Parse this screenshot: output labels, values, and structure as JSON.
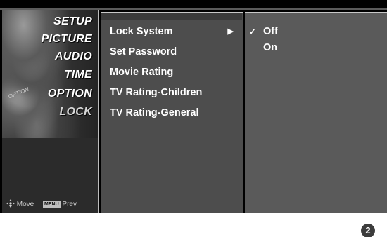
{
  "left_panel": {
    "categories": [
      {
        "label": "SETUP"
      },
      {
        "label": "PICTURE"
      },
      {
        "label": "AUDIO"
      },
      {
        "label": "TIME"
      },
      {
        "label": "OPTION"
      },
      {
        "label": "LOCK",
        "active": true
      }
    ],
    "nav_hint": {
      "move_icon": "move-arrows-icon",
      "move_label": "Move",
      "menu_key": "MENU",
      "prev_label": "Prev"
    }
  },
  "submenu": {
    "items": [
      {
        "label": "Lock System",
        "selected": true,
        "has_submenu": true,
        "arrow": "▶"
      },
      {
        "label": "Set Password"
      },
      {
        "label": "Movie Rating"
      },
      {
        "label": "TV Rating-Children"
      },
      {
        "label": "TV Rating-General"
      }
    ]
  },
  "options": {
    "items": [
      {
        "label": "Off",
        "checked": true,
        "check_mark": "✓"
      },
      {
        "label": "On",
        "checked": false,
        "check_mark": ""
      }
    ]
  },
  "step_badge": "2"
}
